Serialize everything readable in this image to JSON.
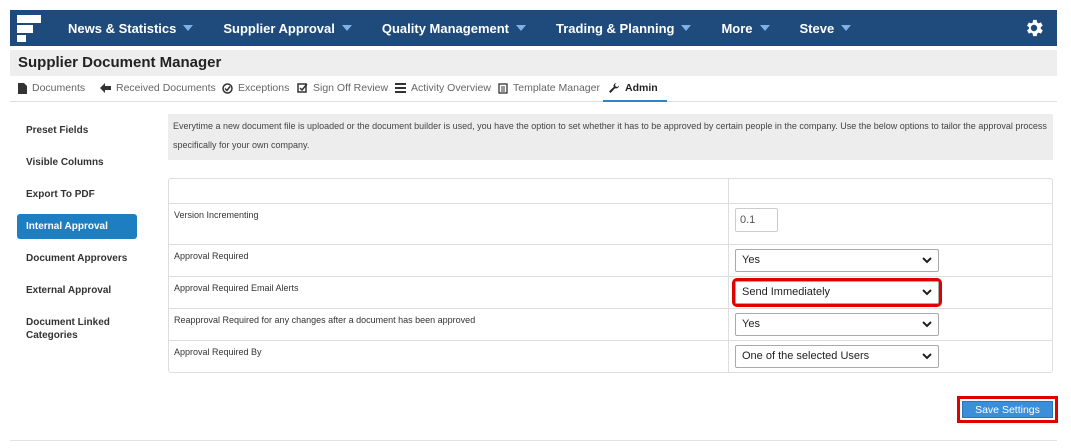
{
  "nav": {
    "items": [
      {
        "label": "News & Statistics"
      },
      {
        "label": "Supplier Approval"
      },
      {
        "label": "Quality Management"
      },
      {
        "label": "Trading & Planning"
      },
      {
        "label": "More"
      },
      {
        "label": "Steve"
      }
    ],
    "icons": {
      "logo": "logo-icon",
      "settings": "gear-icon"
    },
    "colors": {
      "bar": "#1f4a7c",
      "caret": "#7fb0e8"
    }
  },
  "page": {
    "title": "Supplier Document Manager"
  },
  "tabs": [
    {
      "label": "Documents",
      "icon": "document-icon"
    },
    {
      "label": "Received Documents",
      "icon": "arrow-left-icon"
    },
    {
      "label": "Exceptions",
      "icon": "check-circle-icon"
    },
    {
      "label": "Sign Off Review",
      "icon": "check-square-icon"
    },
    {
      "label": "Activity Overview",
      "icon": "list-icon"
    },
    {
      "label": "Template Manager",
      "icon": "template-icon"
    },
    {
      "label": "Admin",
      "icon": "wrench-icon",
      "active": true
    }
  ],
  "sidebar": {
    "items": [
      {
        "label": "Preset Fields"
      },
      {
        "label": "Visible Columns"
      },
      {
        "label": "Export To PDF"
      },
      {
        "label": "Internal Approval",
        "active": true
      },
      {
        "label": "Document Approvers"
      },
      {
        "label": "External Approval"
      },
      {
        "label": "Document Linked Categories"
      }
    ],
    "active_color": "#1d7ec2"
  },
  "intro": "Everytime a new document file is uploaded or the document builder is used, you have the option to set whether it has to be approved by certain people in the company. Use the below options to tailor the approval process specifically for your own company.",
  "settings": {
    "version": {
      "label": "Version Incrementing",
      "value": "0.1"
    },
    "approval_required": {
      "label": "Approval Required",
      "value": "Yes"
    },
    "email_alerts": {
      "label": "Approval Required Email Alerts",
      "value": "Send Immediately"
    },
    "reapproval": {
      "label": "Reapproval Required for any changes after a document has been approved",
      "value": "Yes"
    },
    "approval_by": {
      "label": "Approval Required By",
      "value": "One of the selected Users"
    }
  },
  "actions": {
    "save_label": "Save Settings",
    "highlight_color": "#e00000"
  }
}
